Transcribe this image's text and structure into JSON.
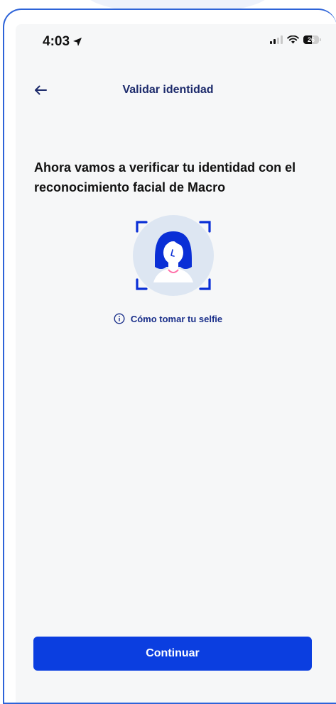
{
  "status_bar": {
    "time": "4:03",
    "battery": "26"
  },
  "header": {
    "title": "Validar identidad",
    "back_icon": "arrow-left-icon"
  },
  "main": {
    "heading": "Ahora vamos a verificar tu identidad con el reconocimiento facial de Macro",
    "illustration": "face-scan-illustration",
    "help_link": "Cómo tomar tu selfie",
    "help_icon": "info-icon"
  },
  "footer": {
    "continue_label": "Continuar"
  },
  "colors": {
    "primary": "#0b3ee0",
    "title": "#1c2a6b",
    "frame": "#2d63d8",
    "background": "#f6f7f8"
  }
}
